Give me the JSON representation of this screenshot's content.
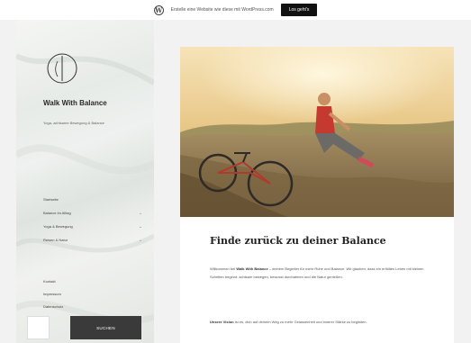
{
  "topbar": {
    "promo_text": "Erstelle eine Website wie diese mit WordPress.com",
    "button_label": "Los geht's"
  },
  "sidebar": {
    "site_title": "Walk With Balance",
    "site_description": "Yoga, achtsame Bewegung & Balance",
    "nav_items": [
      {
        "label": "Startseite",
        "has_submenu": false
      },
      {
        "label": "Balance im Alltag",
        "has_submenu": true
      },
      {
        "label": "Yoga & Bewegung",
        "has_submenu": true
      },
      {
        "label": "Reisen & Natur",
        "has_submenu": true
      }
    ],
    "nav_lower": [
      {
        "label": "Kontakt"
      },
      {
        "label": "Impressum"
      },
      {
        "label": "Datenschutz"
      }
    ],
    "search_button": "SUCHEN"
  },
  "post": {
    "title": "Finde zurück zu deiner Balance",
    "para1_bold": "Walk With Balance",
    "para1_before": "Willkommen bei ",
    "para1_after": " – deinem Begleiter für mehr Ruhe und Balance. Wir glauben, dass ein erfülltes Leben mit kleinen Schritten beginnt: achtsam bewegen, bewusst durchatmen und die Natur genießen.",
    "para2_bold": "Unsere Vision",
    "para2_after": " ist es, dich auf deinem Weg zu mehr Gelassenheit und innerer Stärke zu begleiten."
  },
  "colors": {
    "search_button_bg": "#3a3a3a",
    "promo_button_bg": "#111111",
    "content_bg": "#ffffff",
    "page_bg": "#f2f2f2"
  },
  "icons": {
    "wordpress": "wordpress-icon",
    "logo": "circle-stroke-logo-icon",
    "chevron": "chevron-down-icon"
  }
}
